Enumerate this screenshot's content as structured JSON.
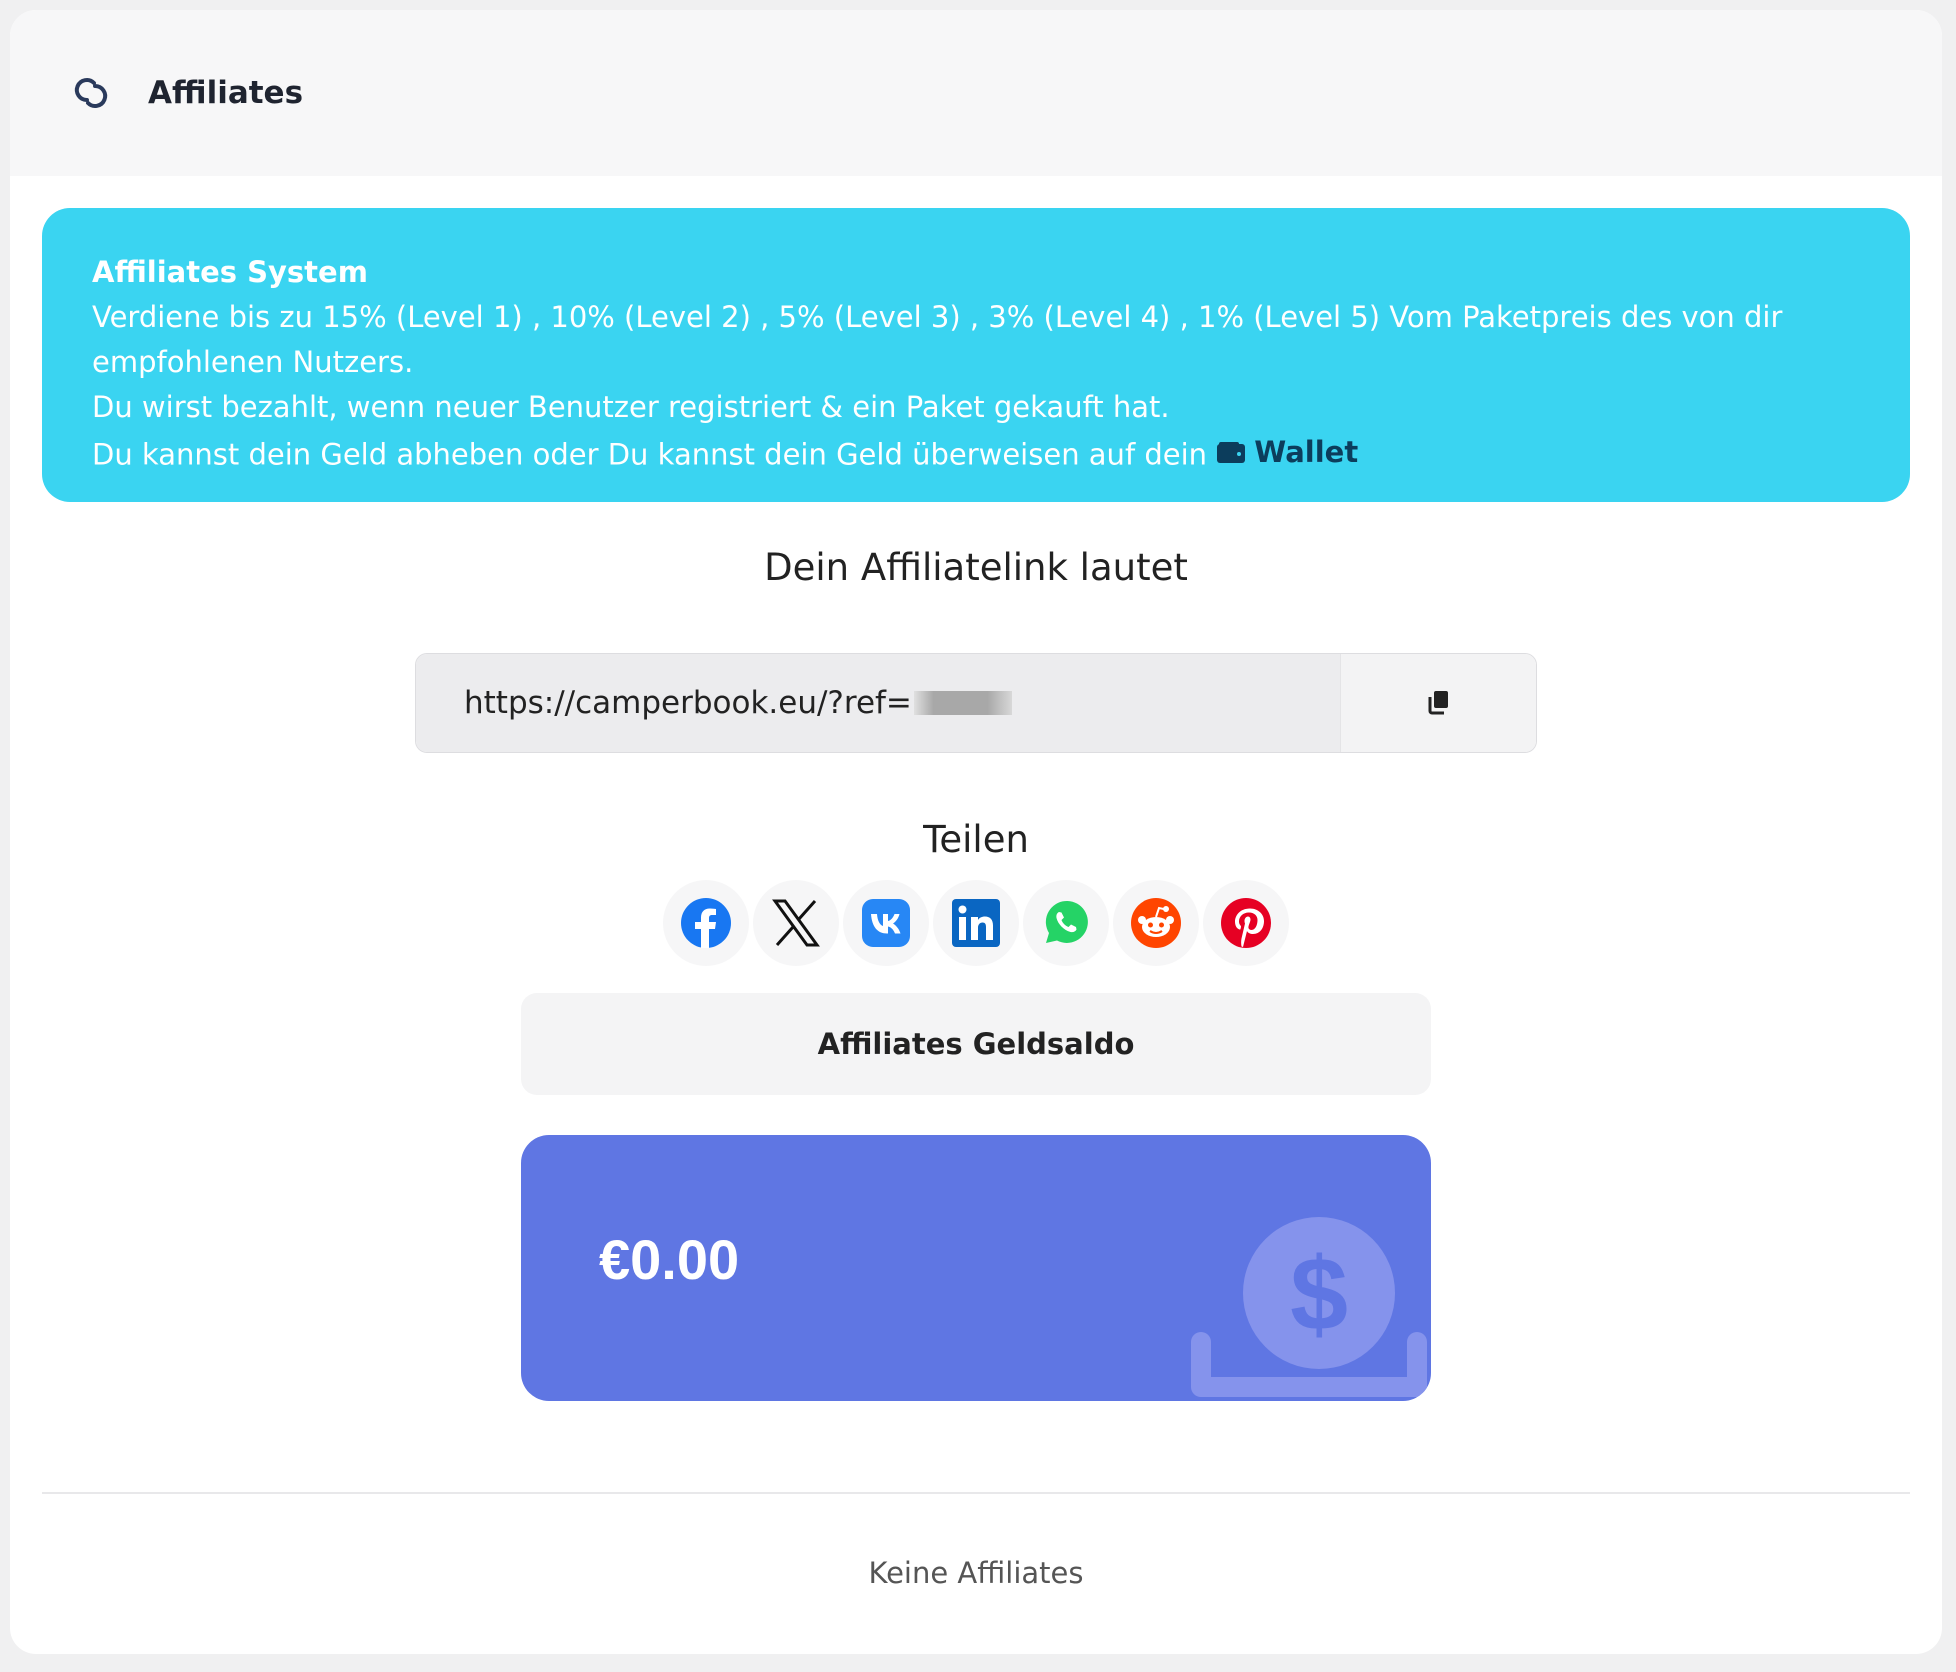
{
  "header": {
    "title": "Affiliates",
    "icon": "link-icon"
  },
  "info": {
    "title": "Affiliates System",
    "line1": "Verdiene bis zu 15% (Level 1) , 10% (Level 2) , 5% (Level 3) , 3% (Level 4) , 1% (Level 5) Vom Paketpreis des von dir empfohlenen Nutzers.",
    "line2": "Du wirst bezahlt, wenn neuer Benutzer registriert & ein Paket gekauft hat.",
    "line3": "Du kannst dein Geld abheben oder Du kannst dein Geld überweisen auf dein",
    "wallet_label": "Wallet",
    "wallet_icon": "wallet-icon"
  },
  "affiliate_link": {
    "heading": "Dein Affiliatelink lautet",
    "value": "https://camperbook.eu/?ref=",
    "copy_icon": "copy-icon"
  },
  "share": {
    "heading": "Teilen",
    "networks": [
      {
        "name": "facebook",
        "color": "#1877f2"
      },
      {
        "name": "x",
        "color": "#111111"
      },
      {
        "name": "vk",
        "color": "#2787f5"
      },
      {
        "name": "linkedin",
        "color": "#0a66c2"
      },
      {
        "name": "whatsapp",
        "color": "#25d366"
      },
      {
        "name": "reddit",
        "color": "#ff4500"
      },
      {
        "name": "pinterest",
        "color": "#e60023"
      }
    ]
  },
  "balance": {
    "label": "Affiliates Geldsaldo",
    "amount": "€0.00",
    "card_color": "#5f76e3",
    "icon": "money-hand-icon"
  },
  "footer": {
    "empty_text": "Keine Affiliates"
  },
  "colors": {
    "info_bg": "#3ad4f1",
    "wallet_text": "#0c3d5c"
  }
}
